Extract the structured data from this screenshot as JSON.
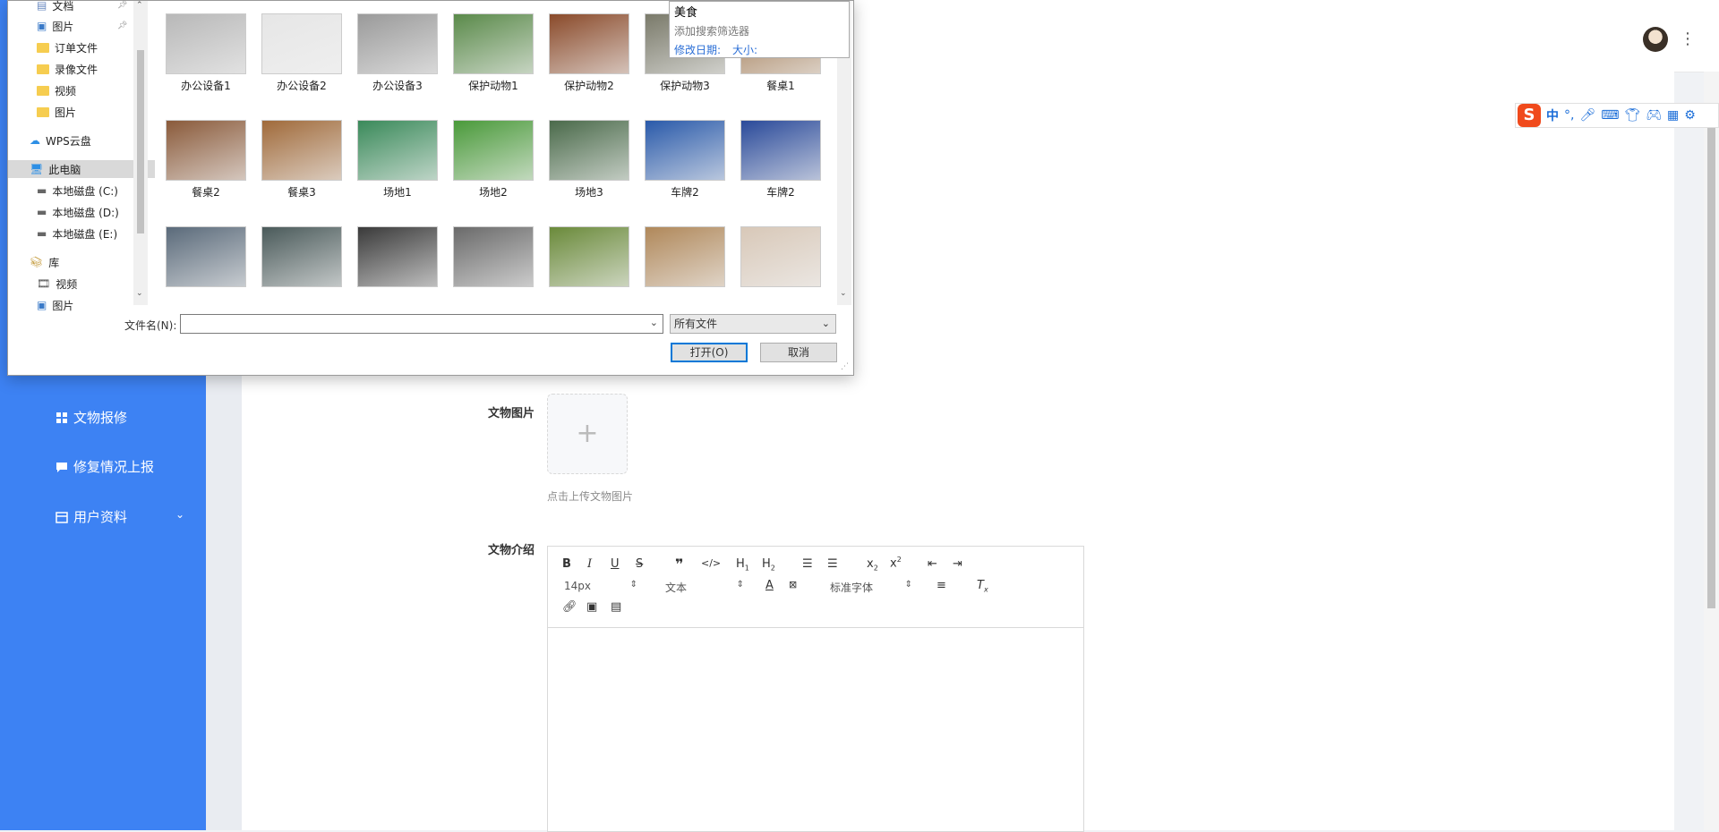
{
  "sidebar": {
    "items": [
      {
        "label": "文物报修",
        "icon": "grid-icon"
      },
      {
        "label": "修复情况上报",
        "icon": "comment-icon"
      },
      {
        "label": "用户资料",
        "icon": "calendar-icon"
      }
    ],
    "color": "#3d82f3"
  },
  "form": {
    "image_label": "文物图片",
    "upload_hint": "点击上传文物图片",
    "intro_label": "文物介绍"
  },
  "editor": {
    "font_size": "14px",
    "block_format": "文本",
    "font_family": "标准字体"
  },
  "ime": {
    "mode": "中",
    "punct": "°,"
  },
  "dialog": {
    "nav_items": [
      {
        "label": "文档",
        "icon": "document-icon",
        "pinned": true
      },
      {
        "label": "图片",
        "icon": "picture-icon",
        "pinned": true
      },
      {
        "label": "订单文件",
        "icon": "folder-icon"
      },
      {
        "label": "录像文件",
        "icon": "folder-icon"
      },
      {
        "label": "视频",
        "icon": "folder-icon"
      },
      {
        "label": "图片",
        "icon": "folder-icon"
      },
      {
        "label": "WPS云盘",
        "icon": "cloud-icon"
      },
      {
        "label": "此电脑",
        "icon": "computer-icon",
        "selected": true
      },
      {
        "label": "本地磁盘 (C:)",
        "icon": "drive-icon"
      },
      {
        "label": "本地磁盘 (D:)",
        "icon": "drive-icon"
      },
      {
        "label": "本地磁盘 (E:)",
        "icon": "drive-icon"
      },
      {
        "label": "库",
        "icon": "library-icon"
      },
      {
        "label": "视频",
        "icon": "video-icon"
      },
      {
        "label": "图片",
        "icon": "picture-icon"
      }
    ],
    "files": [
      {
        "name": "办公设备1",
        "color": "#b8b8b8"
      },
      {
        "name": "办公设备2",
        "color": "#e6e6e6"
      },
      {
        "name": "办公设备3",
        "color": "#9a9a9a"
      },
      {
        "name": "保护动物1",
        "color": "#5a8a4a"
      },
      {
        "name": "保护动物2",
        "color": "#8a4a2a"
      },
      {
        "name": "保护动物3",
        "color": "#7a7a6a"
      },
      {
        "name": "餐桌1",
        "color": "#a07850"
      },
      {
        "name": "餐桌2",
        "color": "#8a5a3a"
      },
      {
        "name": "餐桌3",
        "color": "#a06a3a"
      },
      {
        "name": "场地1",
        "color": "#3a8a5a"
      },
      {
        "name": "场地2",
        "color": "#4a9a3a"
      },
      {
        "name": "场地3",
        "color": "#4a6a4a"
      },
      {
        "name": "车牌2",
        "color": "#2a5aaa"
      },
      {
        "name": "车牌2",
        "color": "#2a4a9a"
      },
      {
        "name": "",
        "color": "#5a6a7a"
      },
      {
        "name": "",
        "color": "#4a5a5a"
      },
      {
        "name": "",
        "color": "#3a3a3a"
      },
      {
        "name": "",
        "color": "#6a6a6a"
      },
      {
        "name": "",
        "color": "#6a8a3a"
      },
      {
        "name": "",
        "color": "#b0885a"
      },
      {
        "name": "",
        "color": "#d8c8b8"
      }
    ],
    "search": {
      "value": "美食",
      "add_filter": "添加搜索筛选器",
      "date_filter": "修改日期:",
      "size_filter": "大小:"
    },
    "filename_label": "文件名(N):",
    "filename_value": "",
    "filetype": "所有文件",
    "open_label": "打开(O)",
    "cancel_label": "取消"
  }
}
